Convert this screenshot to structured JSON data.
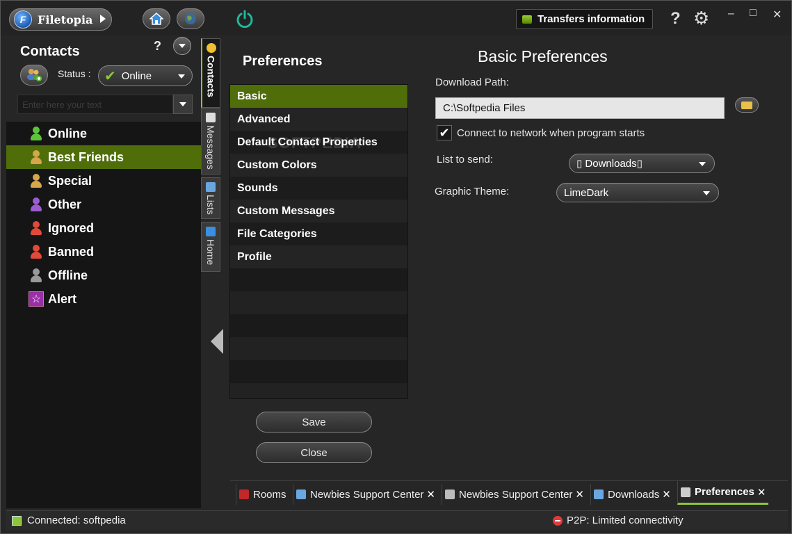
{
  "app": {
    "name": "Filetopia",
    "logo_letter": "F",
    "transfers_label": "Transfers information",
    "help_glyph": "?",
    "window_controls": {
      "minimize": "–",
      "maximize": "□",
      "close": "✕"
    }
  },
  "contacts": {
    "title": "Contacts",
    "help_glyph": "?",
    "status_label": "Status :",
    "status_value": "Online",
    "search_placeholder": "Enter here your text",
    "groups": [
      {
        "label": "Online",
        "icon": "person-green-icon",
        "color": "#5cc43a",
        "selected": false
      },
      {
        "label": "Best Friends",
        "icon": "people-group-icon",
        "color": "#d7a54a",
        "selected": true
      },
      {
        "label": "Special",
        "icon": "people-group-icon",
        "color": "#d7a54a",
        "selected": false
      },
      {
        "label": "Other",
        "icon": "person-purple-icon",
        "color": "#9a5cd0",
        "selected": false
      },
      {
        "label": "Ignored",
        "icon": "person-red-icon",
        "color": "#e04a3a",
        "selected": false
      },
      {
        "label": "Banned",
        "icon": "person-red-icon",
        "color": "#e04a3a",
        "selected": false
      },
      {
        "label": "Offline",
        "icon": "person-grey-icon",
        "color": "#999999",
        "selected": false
      },
      {
        "label": "Alert",
        "icon": "star-icon",
        "color": "#9a2fa8",
        "selected": false
      }
    ]
  },
  "side_tabs": [
    {
      "label": "Contacts",
      "icon": "smiley-icon",
      "active": true
    },
    {
      "label": "Messages",
      "icon": "note-icon",
      "active": false
    },
    {
      "label": "Lists",
      "icon": "window-icon",
      "active": false
    },
    {
      "label": "Home",
      "icon": "home-icon",
      "active": false
    }
  ],
  "preferences": {
    "title": "Preferences",
    "items": [
      {
        "label": "Basic",
        "selected": true
      },
      {
        "label": "Advanced",
        "selected": false
      },
      {
        "label": "Default Contact Properties",
        "selected": false
      },
      {
        "label": "Custom Colors",
        "selected": false
      },
      {
        "label": "Sounds",
        "selected": false
      },
      {
        "label": "Custom Messages",
        "selected": false
      },
      {
        "label": "File Categories",
        "selected": false
      },
      {
        "label": "Profile",
        "selected": false
      }
    ],
    "watermark": "SOFTPEDIA",
    "save_label": "Save",
    "close_label": "Close"
  },
  "basic": {
    "title": "Basic Preferences",
    "download_path_label": "Download Path:",
    "download_path_value": "C:\\Softpedia Files",
    "connect_label": "Connect to network when program starts",
    "connect_checked": true,
    "list_to_send_label": "List to send:",
    "list_to_send_value": "▯ Downloads▯",
    "graphic_theme_label": "Graphic Theme:",
    "graphic_theme_value": "LimeDark"
  },
  "bottom_tabs": [
    {
      "label": "Rooms",
      "closable": false,
      "active": false,
      "icon": "rooms-icon",
      "color": "#c0282a"
    },
    {
      "label": "Newbies Support Center",
      "closable": true,
      "active": false,
      "icon": "chat-icon",
      "color": "#6aa7e0"
    },
    {
      "label": "Newbies Support Center",
      "closable": true,
      "active": false,
      "icon": "list-icon",
      "color": "#bbbbbb"
    },
    {
      "label": "Downloads",
      "closable": true,
      "active": false,
      "icon": "window-icon",
      "color": "#6aa7e0"
    },
    {
      "label": "Preferences",
      "closable": true,
      "active": true,
      "icon": "gear-icon",
      "color": "#cccccc"
    }
  ],
  "status_bar": {
    "connected_text": "Connected: softpedia",
    "p2p_text": "P2P: Limited connectivity"
  }
}
